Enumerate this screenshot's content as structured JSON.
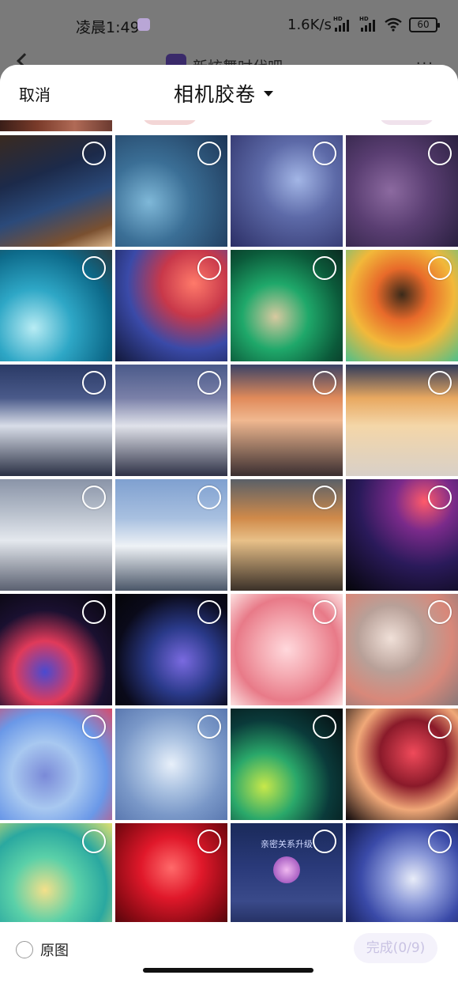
{
  "status_bar": {
    "time": "凌晨1:49",
    "net_speed": "1.6K/s",
    "signal_badge": "HD",
    "battery_level": "60"
  },
  "background_app": {
    "title": "新炫舞吋代吧",
    "more": "···"
  },
  "sheet": {
    "cancel_label": "取消",
    "album_title": "相机胶卷",
    "original_label": "原图",
    "done_label": "完成(0/9)",
    "accent_color": "#c9c3e3"
  },
  "peek_row": {
    "count_visible": 4
  },
  "photos": [
    {
      "kind": "game-screenshot",
      "selected": false
    },
    {
      "kind": "blue-smoke",
      "selected": false
    },
    {
      "kind": "purple-smoke",
      "selected": false
    },
    {
      "kind": "violet-smoke",
      "selected": false
    },
    {
      "kind": "ink-teal",
      "selected": false
    },
    {
      "kind": "ink-red-blue",
      "selected": false
    },
    {
      "kind": "ink-green",
      "selected": false
    },
    {
      "kind": "ink-orange",
      "selected": false
    },
    {
      "kind": "mountain-night",
      "selected": false
    },
    {
      "kind": "mountain-dusk",
      "selected": false
    },
    {
      "kind": "mountain-sunset",
      "selected": false
    },
    {
      "kind": "mountain-gold",
      "selected": false
    },
    {
      "kind": "mountain-grey",
      "selected": false
    },
    {
      "kind": "mountain-blue",
      "selected": false
    },
    {
      "kind": "mountain-amber",
      "selected": false
    },
    {
      "kind": "glass-discs-dark",
      "selected": false
    },
    {
      "kind": "glass-discs-red",
      "selected": false
    },
    {
      "kind": "glass-discs-blue",
      "selected": false
    },
    {
      "kind": "glass-discs-pink",
      "selected": false
    },
    {
      "kind": "glass-discs-taupe",
      "selected": false
    },
    {
      "kind": "glass-discs-sky",
      "selected": false
    },
    {
      "kind": "glass-discs-pale",
      "selected": false
    },
    {
      "kind": "glass-discs-green",
      "selected": false
    },
    {
      "kind": "glass-discs-crimson",
      "selected": false
    },
    {
      "kind": "glass-discs-mint",
      "selected": false
    },
    {
      "kind": "red-splash",
      "selected": false
    },
    {
      "kind": "game-upgrade",
      "game_text": "亲密关系升级",
      "selected": false
    },
    {
      "kind": "crystal-glasses",
      "selected": false
    }
  ]
}
